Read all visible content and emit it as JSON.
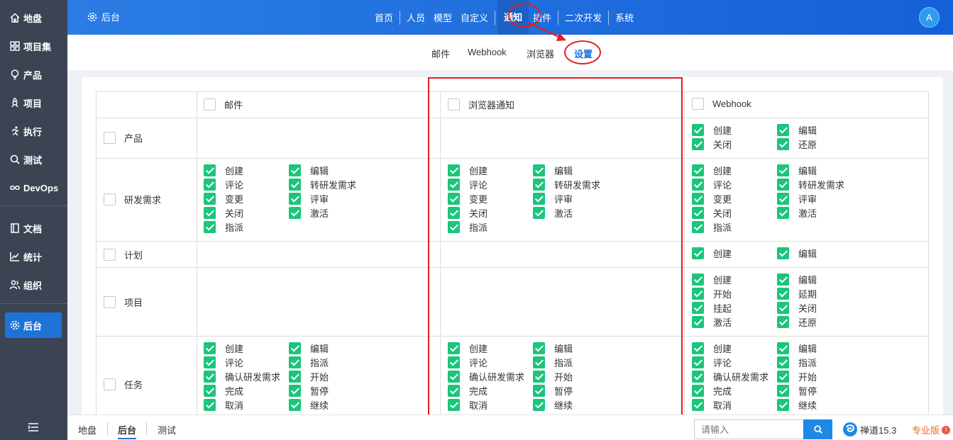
{
  "sidebar": {
    "items": [
      {
        "label": "地盘",
        "icon": "home-icon"
      },
      {
        "label": "项目集",
        "icon": "grid-icon"
      },
      {
        "label": "产品",
        "icon": "bulb-icon"
      },
      {
        "label": "项目",
        "icon": "rocket-icon"
      },
      {
        "label": "执行",
        "icon": "run-icon"
      },
      {
        "label": "测试",
        "icon": "search-icon"
      },
      {
        "label": "DevOps",
        "icon": "infinity-icon"
      },
      {
        "label": "文档",
        "icon": "book-icon"
      },
      {
        "label": "统计",
        "icon": "chart-icon"
      },
      {
        "label": "组织",
        "icon": "people-icon"
      },
      {
        "label": "后台",
        "icon": "gear-icon"
      }
    ],
    "active": "后台"
  },
  "header": {
    "brand": "后台",
    "nav": [
      "首页",
      "人员",
      "模型",
      "自定义",
      "通知",
      "插件",
      "二次开发",
      "系统"
    ],
    "active": "通知",
    "avatar": "A"
  },
  "subnav": {
    "items": [
      "邮件",
      "Webhook",
      "浏览器",
      "设置"
    ],
    "active": "设置"
  },
  "table": {
    "columns": [
      "邮件",
      "浏览器通知",
      "Webhook"
    ],
    "rows": [
      {
        "label": "产品",
        "mail": [],
        "browser": [],
        "webhook": [
          "创建",
          "编辑",
          "关闭",
          "还原"
        ]
      },
      {
        "label": "研发需求",
        "mail": [
          "创建",
          "编辑",
          "评论",
          "转研发需求",
          "变更",
          "评审",
          "关闭",
          "激活",
          "指派"
        ],
        "browser": [
          "创建",
          "编辑",
          "评论",
          "转研发需求",
          "变更",
          "评审",
          "关闭",
          "激活",
          "指派"
        ],
        "webhook": [
          "创建",
          "编辑",
          "评论",
          "转研发需求",
          "变更",
          "评审",
          "关闭",
          "激活",
          "指派"
        ]
      },
      {
        "label": "计划",
        "mail": [],
        "browser": [],
        "webhook": [
          "创建",
          "编辑"
        ]
      },
      {
        "label": "项目",
        "mail": [],
        "browser": [],
        "webhook": [
          "创建",
          "编辑",
          "开始",
          "延期",
          "挂起",
          "关闭",
          "激活",
          "还原"
        ]
      },
      {
        "label": "任务",
        "mail": [
          "创建",
          "编辑",
          "评论",
          "指派",
          "确认研发需求",
          "开始",
          "完成",
          "暂停",
          "取消",
          "继续"
        ],
        "browser": [
          "创建",
          "编辑",
          "评论",
          "指派",
          "确认研发需求",
          "开始",
          "完成",
          "暂停",
          "取消",
          "继续"
        ],
        "webhook": [
          "创建",
          "编辑",
          "评论",
          "指派",
          "确认研发需求",
          "开始",
          "完成",
          "暂停",
          "取消",
          "继续"
        ]
      }
    ]
  },
  "footer": {
    "breadcrumbs": [
      "地盘",
      "后台",
      "测试"
    ],
    "active": "后台",
    "search_placeholder": "请输入",
    "version": "禅道15.3",
    "pro_label": "专业版"
  },
  "colors": {
    "accent": "#1d73d8",
    "check": "#1bc57b",
    "annotation": "#e02020",
    "sidebar": "#3c4353"
  }
}
